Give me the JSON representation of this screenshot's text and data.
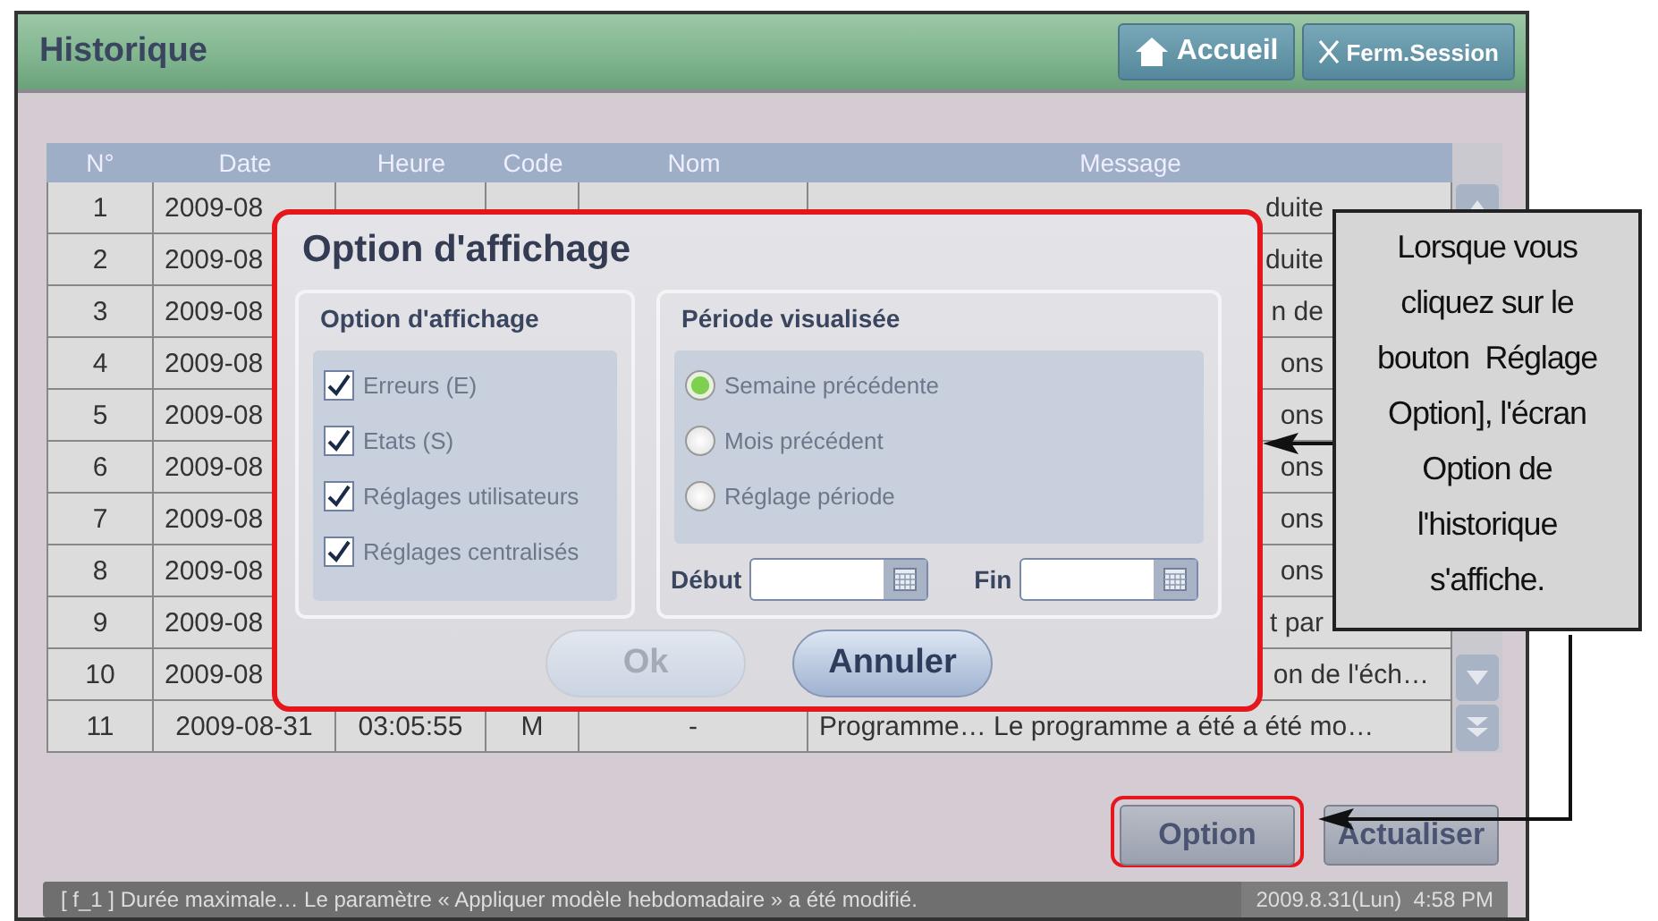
{
  "window": {
    "title": "Historique"
  },
  "header_buttons": [
    {
      "kind": "home",
      "label": "Accueil"
    },
    {
      "kind": "close",
      "label": "Ferm.Session"
    }
  ],
  "table": {
    "columns": [
      "N°",
      "Date",
      "Heure",
      "Code",
      "Nom",
      "Message"
    ],
    "rows": [
      {
        "number": "1",
        "date": "2009-08",
        "message": "duite"
      },
      {
        "number": "2",
        "date": "2009-08",
        "message": "duite"
      },
      {
        "number": "3",
        "date": "2009-08",
        "message": "n de"
      },
      {
        "number": "4",
        "date": "2009-08",
        "message": "ons"
      },
      {
        "number": "5",
        "date": "2009-08",
        "message": "ons"
      },
      {
        "number": "6",
        "date": "2009-08",
        "message": "ons"
      },
      {
        "number": "7",
        "date": "2009-08",
        "message": "ons"
      },
      {
        "number": "8",
        "date": "2009-08",
        "message": "ons"
      },
      {
        "number": "9",
        "date": "2009-08",
        "message": "t par"
      },
      {
        "number": "10",
        "date": "2009-08",
        "message": "on de l'éch…"
      },
      {
        "number": "11",
        "date": "2009-08-31",
        "time": "03:05:55",
        "code": "M",
        "name": "-",
        "message": "Programme… Le programme a été a été mo…"
      }
    ]
  },
  "dialog": {
    "title": "Option d'affichage",
    "display_group": {
      "title": "Option d'affichage",
      "options": [
        {
          "label": "Erreurs (E)",
          "checked": true
        },
        {
          "label": "Etats (S)",
          "checked": true
        },
        {
          "label": "Réglages utilisateurs",
          "checked": true
        },
        {
          "label": "Réglages centralisés",
          "checked": true
        }
      ]
    },
    "period_group": {
      "title": "Période visualisée",
      "options": [
        {
          "label": "Semaine précédente",
          "selected": true
        },
        {
          "label": "Mois précédent",
          "selected": false
        },
        {
          "label": "Réglage période",
          "selected": false
        }
      ],
      "start": {
        "label": "Début"
      },
      "end": {
        "label": "Fin"
      }
    },
    "buttons": [
      {
        "label": "Ok",
        "disabled": true
      },
      {
        "label": "Annuler",
        "disabled": false
      }
    ]
  },
  "footer_buttons": [
    {
      "label": "Option",
      "highlighted": true
    },
    {
      "label": "Actualiser",
      "highlighted": false
    }
  ],
  "status_bar": {
    "message": "[ f_1 ] Durée maximale… Le paramètre « Appliquer modèle hebdomadaire » a été modifié.",
    "datetime": "2009.8.31(Lun)  4:58 PM"
  },
  "callout": {
    "lines": [
      "Lorsque vous",
      "cliquez sur le",
      "bouton  Réglage",
      "Option], l'écran",
      "Option de",
      "l'historique",
      "s'affiche."
    ]
  }
}
